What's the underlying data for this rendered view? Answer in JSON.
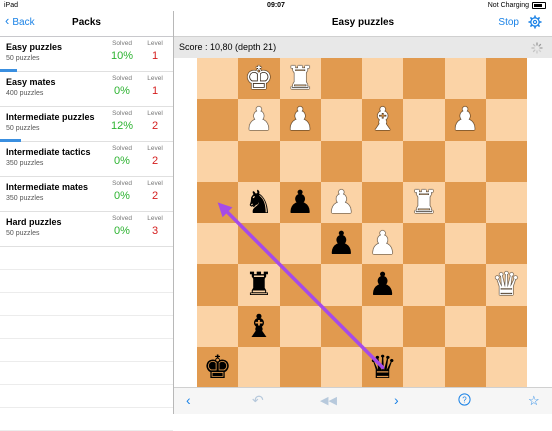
{
  "status": {
    "device": "iPad",
    "time": "09:07",
    "charging": "Not Charging"
  },
  "left": {
    "back_label": "Back",
    "title": "Packs",
    "solved_label": "Solved",
    "level_label": "Level",
    "packs": [
      {
        "name": "Easy puzzles",
        "count": "50 puzzles",
        "solved": "10%",
        "level": "1",
        "progress": 0.1
      },
      {
        "name": "Easy mates",
        "count": "400 puzzles",
        "solved": "0%",
        "level": "1",
        "progress": 0
      },
      {
        "name": "Intermediate puzzles",
        "count": "50 puzzles",
        "solved": "12%",
        "level": "2",
        "progress": 0.12
      },
      {
        "name": "Intermediate tactics",
        "count": "350 puzzles",
        "solved": "0%",
        "level": "2",
        "progress": 0
      },
      {
        "name": "Intermediate mates",
        "count": "350 puzzles",
        "solved": "0%",
        "level": "2",
        "progress": 0
      },
      {
        "name": "Hard puzzles",
        "count": "50 puzzles",
        "solved": "0%",
        "level": "3",
        "progress": 0
      }
    ]
  },
  "main": {
    "title": "Easy puzzles",
    "stop_label": "Stop",
    "score": "Score : 10,80 (depth 21)",
    "board": [
      [
        "",
        "wk",
        "wr",
        "",
        "",
        "",
        "",
        ""
      ],
      [
        "",
        "wp",
        "wp",
        "",
        "wb",
        "",
        "wp",
        ""
      ],
      [
        "",
        "",
        "",
        "",
        "",
        "",
        "",
        ""
      ],
      [
        "",
        "bn",
        "bp",
        "wp",
        "",
        "wr",
        "",
        ""
      ],
      [
        "",
        "",
        "",
        "bp",
        "wp",
        "",
        "",
        ""
      ],
      [
        "",
        "br",
        "",
        "",
        "bp",
        "",
        "",
        "wq"
      ],
      [
        "",
        "bb",
        "",
        "",
        "",
        "",
        "",
        ""
      ],
      [
        "bk",
        "",
        "",
        "",
        "bq",
        "",
        "",
        ""
      ]
    ],
    "arrow": {
      "from": [
        7,
        4
      ],
      "to": [
        3,
        0
      ],
      "color": "#a64be8"
    }
  },
  "colors": {
    "accent": "#1a82e6",
    "solved": "#2cb330",
    "level": "#d41c1c",
    "light_square": "#fbd3a6",
    "dark_square": "#e19a4f"
  }
}
